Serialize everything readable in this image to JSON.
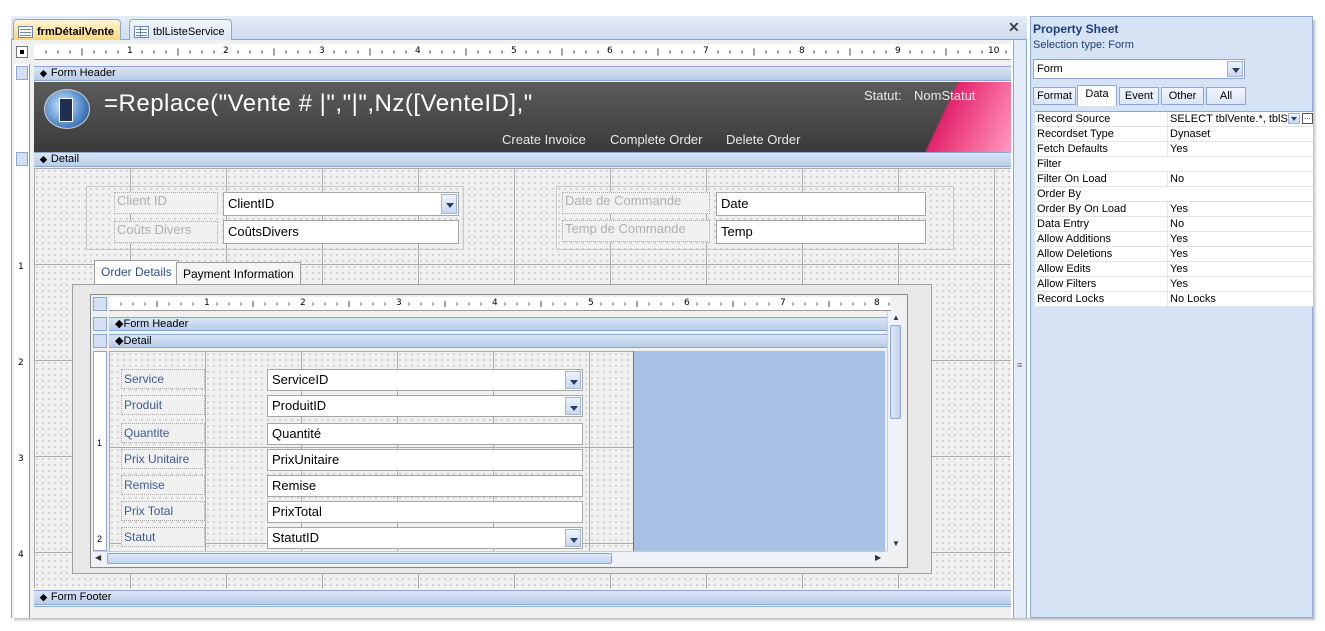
{
  "document_tabs": [
    {
      "label": "frmDétailVente",
      "active": true
    },
    {
      "label": "tblListeService",
      "active": false
    }
  ],
  "close_glyph": "✕",
  "ruler": {
    "main_numbers": [
      "1",
      "2",
      "3",
      "4",
      "5",
      "6",
      "7",
      "8",
      "9",
      "10"
    ],
    "vertical_numbers": [
      "1",
      "2",
      "3",
      "4"
    ],
    "sub_numbers": [
      "1",
      "2",
      "3",
      "4",
      "5",
      "6",
      "7",
      "8"
    ],
    "sub_vertical_numbers": [
      "1",
      "2"
    ]
  },
  "sections": {
    "form_header": "Form Header",
    "detail": "Detail",
    "form_footer": "Form Footer"
  },
  "form_header": {
    "expression": "=Replace(\"Vente # |\",\"|\",Nz([VenteID],\"",
    "statut_label": "Statut:",
    "statut_control": "NomStatut",
    "buttons": [
      "Create Invoice",
      "Complete Order",
      "Delete Order"
    ]
  },
  "detail": {
    "client_label": "Client ID",
    "client_value": "ClientID",
    "couts_label": "Coûts Divers",
    "couts_value": "CoûtsDivers",
    "date_label": "Date de Commande",
    "date_value": "Date",
    "temp_label": "Temp de Commande",
    "temp_value": "Temp"
  },
  "tab_control": {
    "tabs": [
      "Order Details",
      "Payment Information"
    ]
  },
  "subform": {
    "header": "Form Header",
    "detail": "Detail",
    "fields": [
      {
        "label": "Service",
        "value": "ServiceID",
        "combo": true
      },
      {
        "label": "Produit",
        "value": "ProduitID",
        "combo": true
      },
      {
        "label": "Quantite",
        "value": "Quantité",
        "combo": false
      },
      {
        "label": "Prix Unitaire",
        "value": "PrixUnitaire",
        "combo": false
      },
      {
        "label": "Remise",
        "value": "Remise",
        "combo": false
      },
      {
        "label": "Prix Total",
        "value": "PrixTotal",
        "combo": false
      },
      {
        "label": "Statut",
        "value": "StatutID",
        "combo": true
      }
    ]
  },
  "property_sheet": {
    "title": "Property Sheet",
    "selection_type_label": "Selection type:",
    "selection_type": "Form",
    "selector_value": "Form",
    "tabs": [
      "Format",
      "Data",
      "Event",
      "Other",
      "All"
    ],
    "active_tab": "Data",
    "rows": [
      {
        "name": "Record Source",
        "value": "SELECT tblVente.*, tblSt"
      },
      {
        "name": "Recordset Type",
        "value": "Dynaset"
      },
      {
        "name": "Fetch Defaults",
        "value": "Yes"
      },
      {
        "name": "Filter",
        "value": ""
      },
      {
        "name": "Filter On Load",
        "value": "No"
      },
      {
        "name": "Order By",
        "value": ""
      },
      {
        "name": "Order By On Load",
        "value": "Yes"
      },
      {
        "name": "Data Entry",
        "value": "No"
      },
      {
        "name": "Allow Additions",
        "value": "Yes"
      },
      {
        "name": "Allow Deletions",
        "value": "Yes"
      },
      {
        "name": "Allow Edits",
        "value": "Yes"
      },
      {
        "name": "Allow Filters",
        "value": "Yes"
      },
      {
        "name": "Record Locks",
        "value": "No Locks"
      }
    ]
  }
}
